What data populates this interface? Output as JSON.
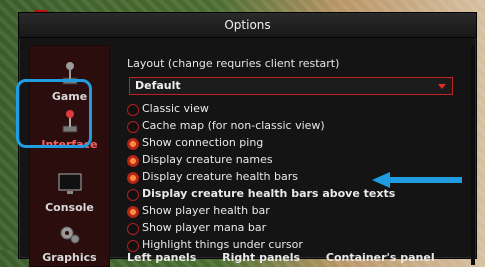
{
  "window": {
    "title": "Options"
  },
  "sidebar": {
    "items": [
      {
        "label": "Game",
        "icon": "joystick-icon"
      },
      {
        "label": "Interface",
        "icon": "joystick-red-icon",
        "selected": true
      },
      {
        "label": "Console",
        "icon": "monitor-icon"
      },
      {
        "label": "Graphics",
        "icon": "gears-icon"
      }
    ]
  },
  "layout": {
    "label": "Layout (change requries client restart)",
    "selected": "Default"
  },
  "options": [
    {
      "label": "Classic view",
      "checked": false
    },
    {
      "label": "Cache map (for non-classic view)",
      "checked": false
    },
    {
      "label": "Show connection ping",
      "checked": true
    },
    {
      "label": "Display creature names",
      "checked": true
    },
    {
      "label": "Display creature health bars",
      "checked": true
    },
    {
      "label": "Display creature health bars above texts",
      "checked": false
    },
    {
      "label": "Show player health bar",
      "checked": true
    },
    {
      "label": "Show player mana bar",
      "checked": false
    },
    {
      "label": "Highlight things under cursor",
      "checked": false
    }
  ],
  "bottom": {
    "left_panels": "Left panels",
    "right_panels": "Right panels",
    "containers_panel": "Container's panel"
  },
  "colors": {
    "accent_red": "#c12121",
    "highlight_blue": "#1f9de0",
    "arrow_blue": "#1f9de0"
  }
}
